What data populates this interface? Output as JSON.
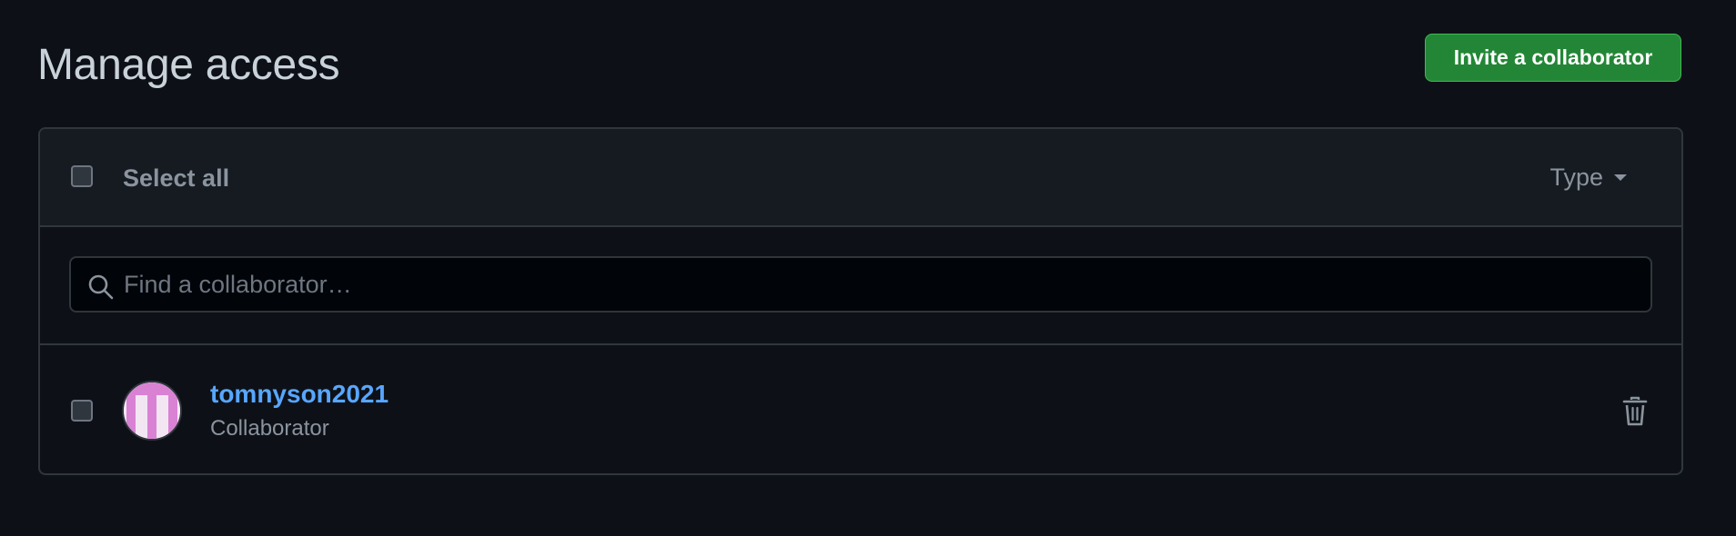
{
  "header": {
    "title": "Manage access",
    "invite_label": "Invite a collaborator"
  },
  "list_header": {
    "select_all_label": "Select all",
    "type_filter_label": "Type"
  },
  "search": {
    "placeholder": "Find a collaborator…",
    "value": ""
  },
  "collaborators": [
    {
      "username": "tomnyson2021",
      "role": "Collaborator",
      "avatar_icon": "identicon-avatar",
      "action_icon": "trash-icon"
    }
  ],
  "colors": {
    "background": "#0d1117",
    "accent_green": "#238636",
    "link_blue": "#58a6ff",
    "avatar_pink": "#d982d4"
  }
}
